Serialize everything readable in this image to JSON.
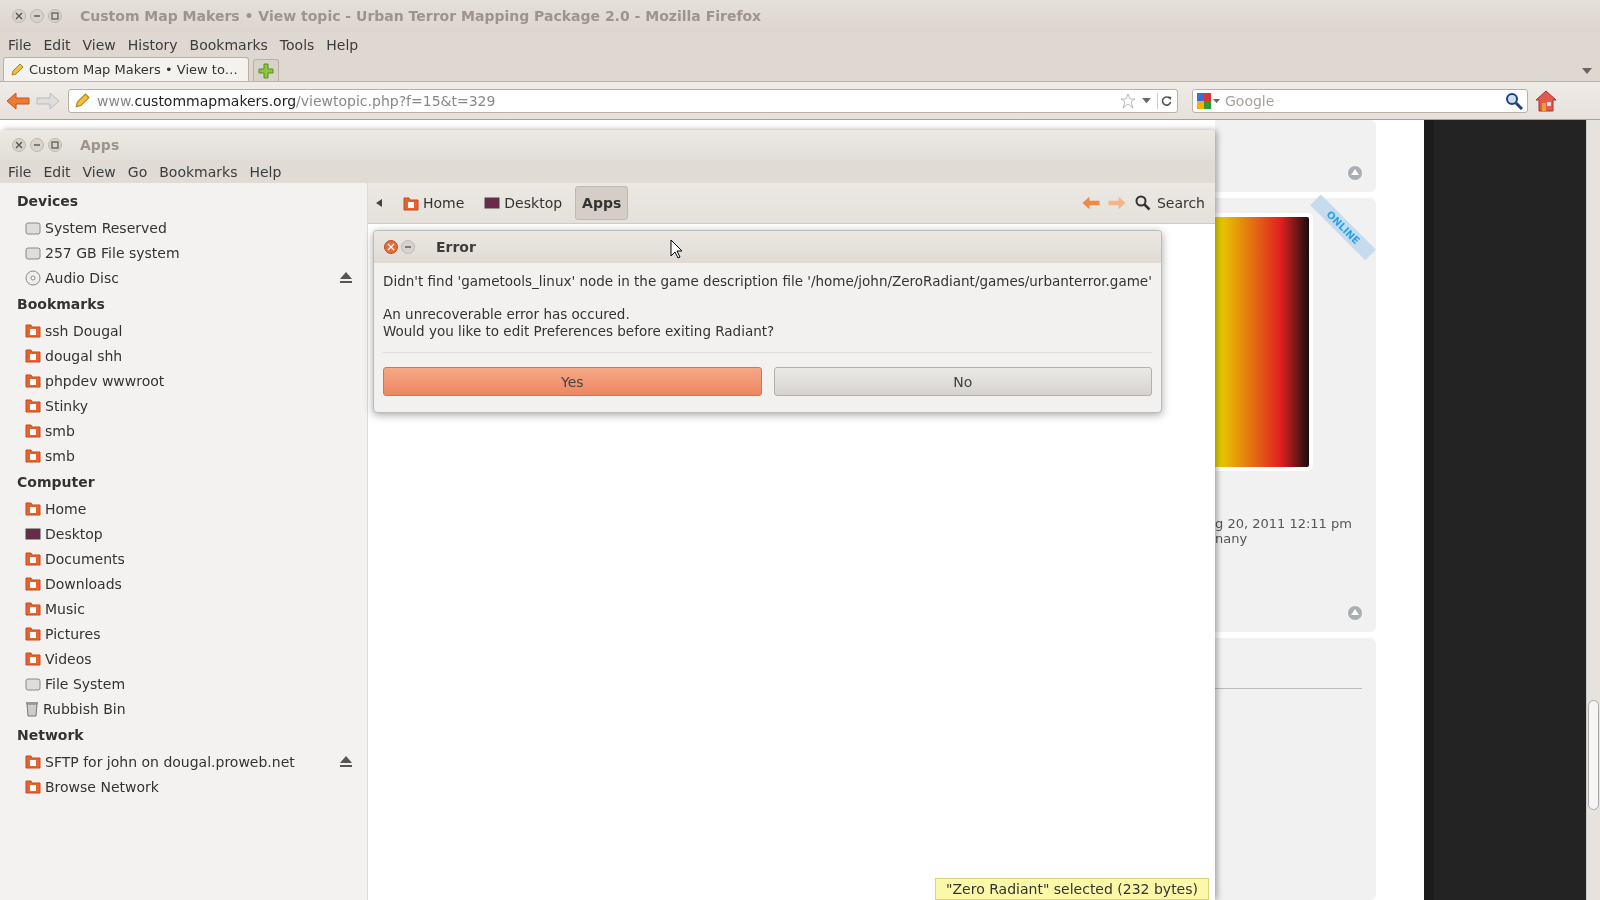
{
  "browser": {
    "title": "Custom Map Makers • View topic - Urban Terror Mapping Package 2.0 - Mozilla Firefox",
    "menu": [
      "File",
      "Edit",
      "View",
      "History",
      "Bookmarks",
      "Tools",
      "Help"
    ],
    "tabs": [
      {
        "label": "Custom Map Makers • View to…",
        "selected": true
      }
    ],
    "url": {
      "prefix": "www.",
      "host": "custommapmakers.org",
      "path": "/viewtopic.php?f=15&t=329"
    },
    "search": {
      "placeholder": "Google"
    }
  },
  "page": {
    "ribbon": "ONLINE",
    "post_date": "g 20, 2011 12:11 pm",
    "post_location": "nany"
  },
  "file_manager": {
    "title": "Apps",
    "menu": [
      "File",
      "Edit",
      "View",
      "Go",
      "Bookmarks",
      "Help"
    ],
    "sidebar": [
      {
        "heading": "Devices",
        "items": [
          {
            "label": "System Reserved",
            "kind": "drive",
            "eject": false
          },
          {
            "label": "257 GB File system",
            "kind": "drive",
            "eject": false
          },
          {
            "label": "Audio Disc",
            "kind": "disc",
            "eject": true
          }
        ]
      },
      {
        "heading": "Bookmarks",
        "items": [
          {
            "label": "ssh Dougal",
            "kind": "folder",
            "eject": false
          },
          {
            "label": "dougal shh",
            "kind": "folder",
            "eject": false
          },
          {
            "label": "phpdev wwwroot",
            "kind": "folder",
            "eject": false
          },
          {
            "label": "Stinky",
            "kind": "folder",
            "eject": false
          },
          {
            "label": "smb",
            "kind": "folder",
            "eject": false
          },
          {
            "label": "smb",
            "kind": "folder",
            "eject": false
          }
        ]
      },
      {
        "heading": "Computer",
        "items": [
          {
            "label": "Home",
            "kind": "folder",
            "eject": false
          },
          {
            "label": "Desktop",
            "kind": "desktop",
            "eject": false
          },
          {
            "label": "Documents",
            "kind": "folder",
            "eject": false
          },
          {
            "label": "Downloads",
            "kind": "folder",
            "eject": false
          },
          {
            "label": "Music",
            "kind": "folder",
            "eject": false
          },
          {
            "label": "Pictures",
            "kind": "folder",
            "eject": false
          },
          {
            "label": "Videos",
            "kind": "folder",
            "eject": false
          },
          {
            "label": "File System",
            "kind": "drive",
            "eject": false
          },
          {
            "label": "Rubbish Bin",
            "kind": "trash",
            "eject": false
          }
        ]
      },
      {
        "heading": "Network",
        "items": [
          {
            "label": "SFTP for john on dougal.proweb.net",
            "kind": "folder",
            "eject": true
          },
          {
            "label": "Browse Network",
            "kind": "folder",
            "eject": false
          }
        ]
      }
    ],
    "path": [
      {
        "label": "Home",
        "kind": "folder",
        "selected": false
      },
      {
        "label": "Desktop",
        "kind": "desktop",
        "selected": false
      },
      {
        "label": "Apps",
        "kind": "none",
        "selected": true
      }
    ],
    "search": "Search",
    "status": "\"Zero Radiant\" selected (232 bytes)"
  },
  "dialog": {
    "title": "Error",
    "message": "Didn't find 'gametools_linux' node in the game description file '/home/john/ZeroRadiant/games/urbanterror.game'",
    "details": [
      "An unrecoverable error has occured.",
      "Would you like to edit Preferences before exiting Radiant?"
    ],
    "buttons": [
      {
        "label": "Yes",
        "kind": "default"
      },
      {
        "label": "No",
        "kind": "normal"
      }
    ]
  }
}
